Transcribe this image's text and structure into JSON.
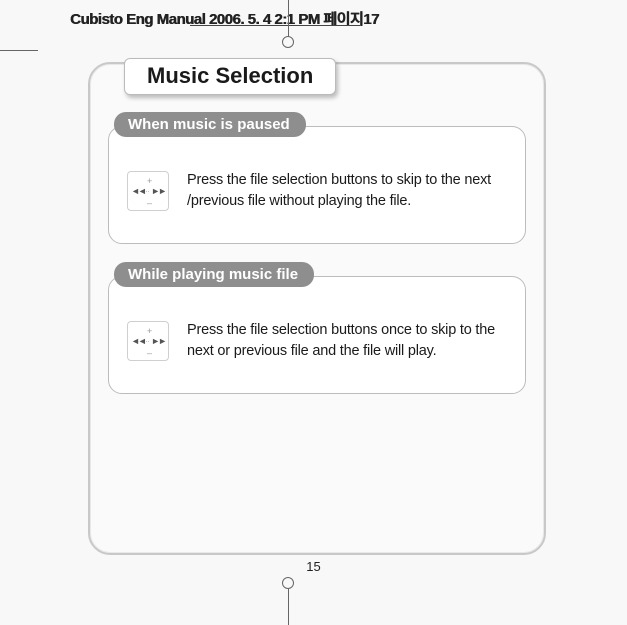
{
  "header": {
    "source_line": "Cubisto Eng Manual  2006. 5. 4  2:1 PM  페이지17"
  },
  "page": {
    "title": "Music Selection",
    "sections": [
      {
        "pill": "When music is paused",
        "body": "Press the file selection buttons to skip to the next /previous file without playing the file."
      },
      {
        "pill": "While playing music file",
        "body": "Press the file selection buttons once to skip to the next or previous file and the file will play."
      }
    ],
    "number": "15"
  }
}
